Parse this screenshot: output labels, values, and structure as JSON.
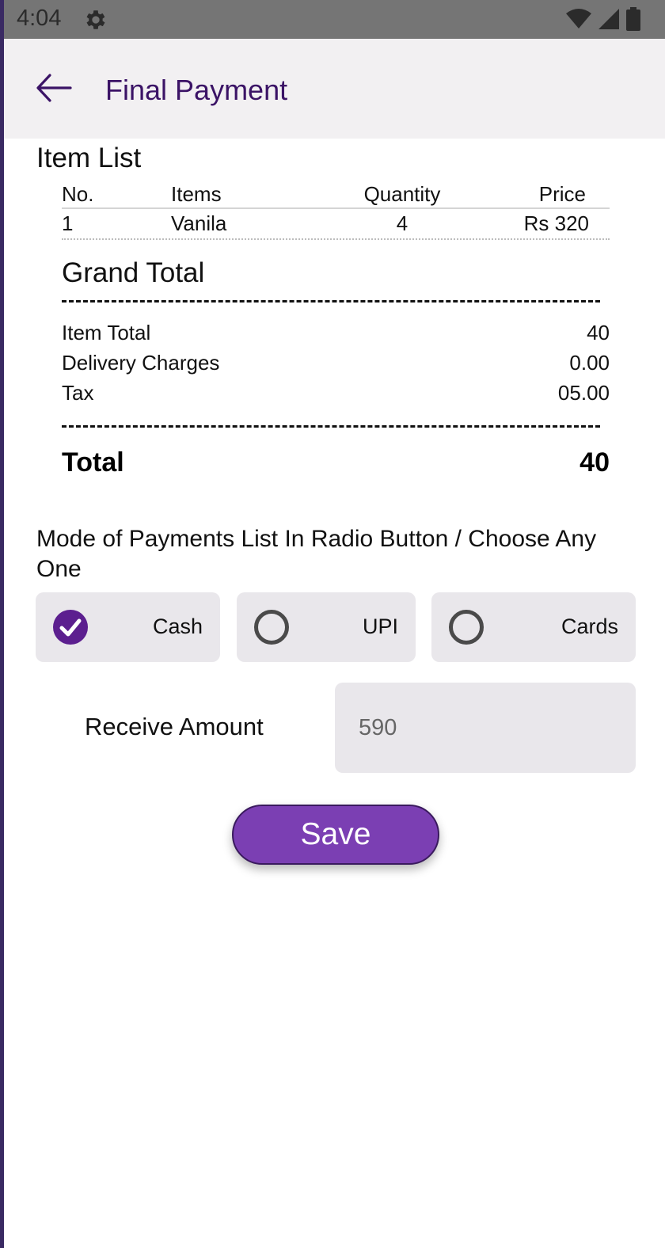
{
  "status_bar": {
    "time": "4:04"
  },
  "app_bar": {
    "title": "Final Payment"
  },
  "item_list": {
    "title": "Item List",
    "columns": [
      "No.",
      "Items",
      "Quantity",
      "Price"
    ],
    "rows": [
      {
        "no": "1",
        "item": "Vanila",
        "quantity": "4",
        "price": "Rs 320"
      }
    ]
  },
  "grand_total": {
    "title": "Grand Total",
    "lines": [
      {
        "label": "Item Total",
        "value": "40"
      },
      {
        "label": "Delivery Charges",
        "value": "0.00"
      },
      {
        "label": "Tax",
        "value": "05.00"
      }
    ],
    "total_label": "Total",
    "total_value": "40"
  },
  "payment": {
    "title": "Mode of Payments List In Radio Button / Choose Any One",
    "options": [
      {
        "label": "Cash",
        "selected": true
      },
      {
        "label": "UPI",
        "selected": false
      },
      {
        "label": "Cards",
        "selected": false
      }
    ],
    "receive_label": "Receive Amount",
    "receive_value": "590"
  },
  "save_label": "Save",
  "colors": {
    "accent": "#7b3fb3",
    "title": "#3b1366",
    "radio_selected": "#5c1f8f",
    "radio_unselected": "#4a4a4a",
    "option_bg": "#e9e7eb"
  },
  "icons": {
    "back": "arrow-left-icon",
    "settings": "gear-icon",
    "wifi": "wifi-icon",
    "signal": "signal-icon",
    "battery": "battery-icon"
  }
}
